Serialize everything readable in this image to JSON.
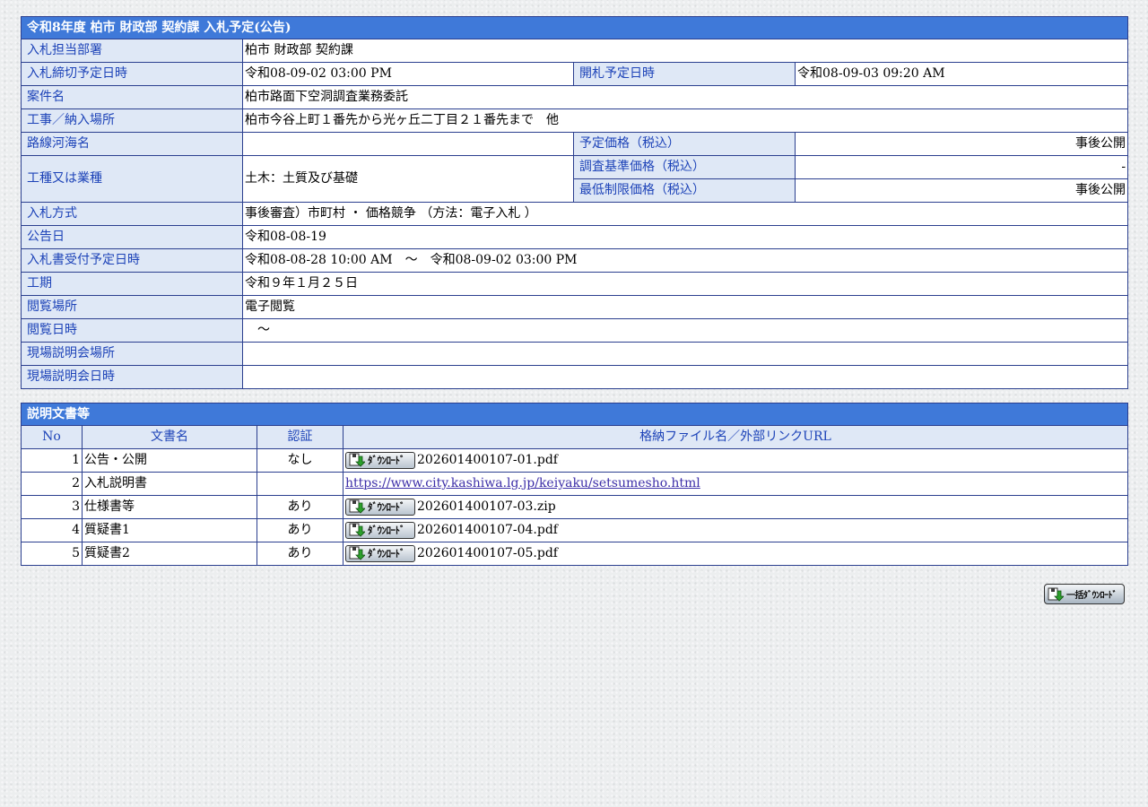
{
  "bid": {
    "caption": "令和8年度 柏市 財政部 契約課 入札予定(公告)",
    "rows": {
      "department": {
        "label": "入札担当部署",
        "value": "柏市 財政部 契約課"
      },
      "deadline": {
        "label": "入札締切予定日時",
        "value": "令和08-09-02 03:00 PM"
      },
      "opening": {
        "label": "開札予定日時",
        "value": "令和08-09-03 09:20 AM"
      },
      "project_name": {
        "label": "案件名",
        "value": "柏市路面下空洞調査業務委託"
      },
      "location": {
        "label": "工事／納入場所",
        "value": "柏市今谷上町１番先から光ヶ丘二丁目２１番先まで　他"
      },
      "route": {
        "label": "路線河海名",
        "value": ""
      },
      "planned_price": {
        "label": "予定価格（税込）",
        "value": "事後公開"
      },
      "work_type": {
        "label": "工種又は業種",
        "value": "土木：土質及び基礎"
      },
      "survey_price": {
        "label": "調査基準価格（税込）",
        "value": "-"
      },
      "min_price": {
        "label": "最低制限価格（税込）",
        "value": "事後公開"
      },
      "method": {
        "label": "入札方式",
        "value": "事後審査）市町村 ・ 価格競争 （方法：電子入札 ）"
      },
      "notice_date": {
        "label": "公告日",
        "value": "令和08-08-19"
      },
      "reception": {
        "label": "入札書受付予定日時",
        "value": "令和08-08-28 10:00 AM　～　令和08-09-02 03:00 PM"
      },
      "period": {
        "label": "工期",
        "value": "令和９年１月２５日"
      },
      "viewing_place": {
        "label": "閲覧場所",
        "value": "電子閲覧"
      },
      "viewing_date": {
        "label": "閲覧日時",
        "value": "　～"
      },
      "briefing_place": {
        "label": "現場説明会場所",
        "value": ""
      },
      "briefing_date": {
        "label": "現場説明会日時",
        "value": ""
      }
    }
  },
  "docs": {
    "caption": "説明文書等",
    "headers": {
      "no": "No",
      "name": "文書名",
      "auth": "認証",
      "file": "格納ファイル名／外部リンクURL"
    },
    "download_label": "ﾀﾞｳﾝﾛｰﾄﾞ",
    "items": [
      {
        "no": "1",
        "name": "公告・公開",
        "auth": "なし",
        "file": "202601400107-01.pdf"
      },
      {
        "no": "2",
        "name": "入札説明書",
        "auth": "",
        "url": "https://www.city.kashiwa.lg.jp/keiyaku/setsumesho.html"
      },
      {
        "no": "3",
        "name": "仕様書等",
        "auth": "あり",
        "file": "202601400107-03.zip"
      },
      {
        "no": "4",
        "name": "質疑書1",
        "auth": "あり",
        "file": "202601400107-04.pdf"
      },
      {
        "no": "5",
        "name": "質疑書2",
        "auth": "あり",
        "file": "202601400107-05.pdf"
      }
    ]
  },
  "bulk_download": {
    "label": "一括ﾀﾞｳﾝﾛｰﾄﾞ"
  },
  "icons": {
    "download": "download-icon"
  },
  "colors": {
    "caption_bg": "#3f79d9",
    "label_bg": "#dfe8f6",
    "label_text": "#1d43b8",
    "border": "#2b3f8f"
  }
}
